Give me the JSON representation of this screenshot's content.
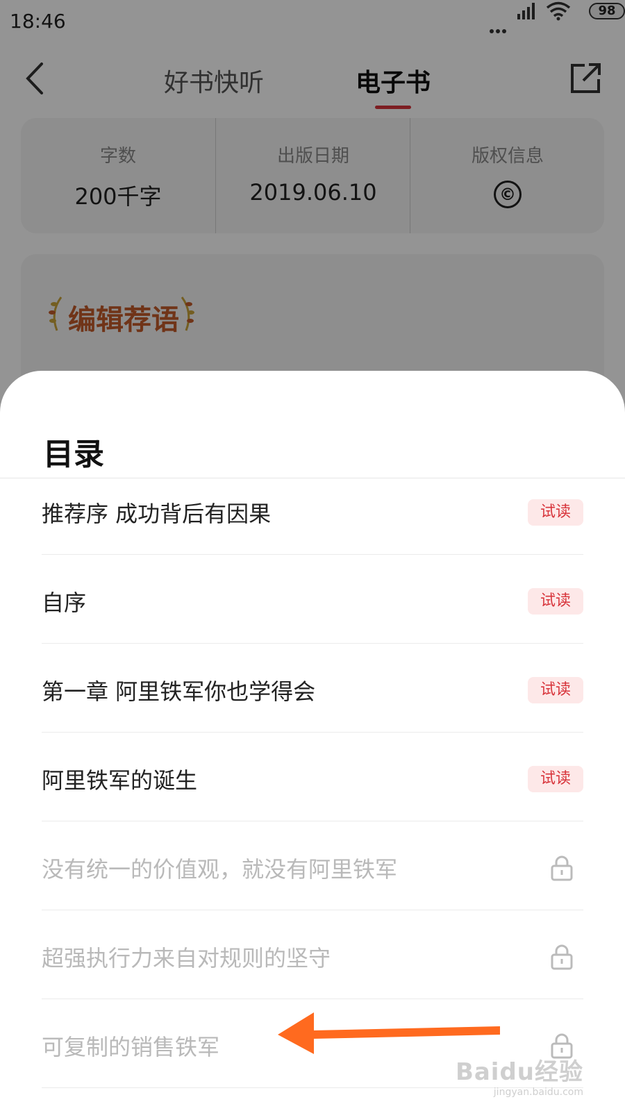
{
  "status_bar": {
    "time": "18:46",
    "battery": "98"
  },
  "nav": {
    "tabs": [
      {
        "label": "好书快听"
      },
      {
        "label": "电子书"
      }
    ]
  },
  "info": [
    {
      "label": "字数",
      "value": "200千字"
    },
    {
      "label": "出版日期",
      "value": "2019.06.10"
    },
    {
      "label": "版权信息",
      "value": "©"
    }
  ],
  "recommend": {
    "title": "编辑荐语"
  },
  "sheet": {
    "title": "目录",
    "items": [
      {
        "title": "推荐序 成功背后有因果",
        "badge": "试读"
      },
      {
        "title": "自序",
        "badge": "试读"
      },
      {
        "title": "第一章 阿里铁军你也学得会",
        "badge": "试读"
      },
      {
        "title": "阿里铁军的诞生",
        "badge": "试读"
      },
      {
        "title": "没有统一的价值观，就没有阿里铁军",
        "locked": true
      },
      {
        "title": "超强执行力来自对规则的坚守",
        "locked": true
      },
      {
        "title": "可复制的销售铁军",
        "locked": true
      }
    ]
  },
  "watermark": {
    "main": "Baidu经验",
    "sub": "jingyan.baidu.com"
  },
  "colors": {
    "accent": "#d8343b",
    "arrow": "#ff6a1f",
    "badge_bg": "#fde8e8"
  }
}
